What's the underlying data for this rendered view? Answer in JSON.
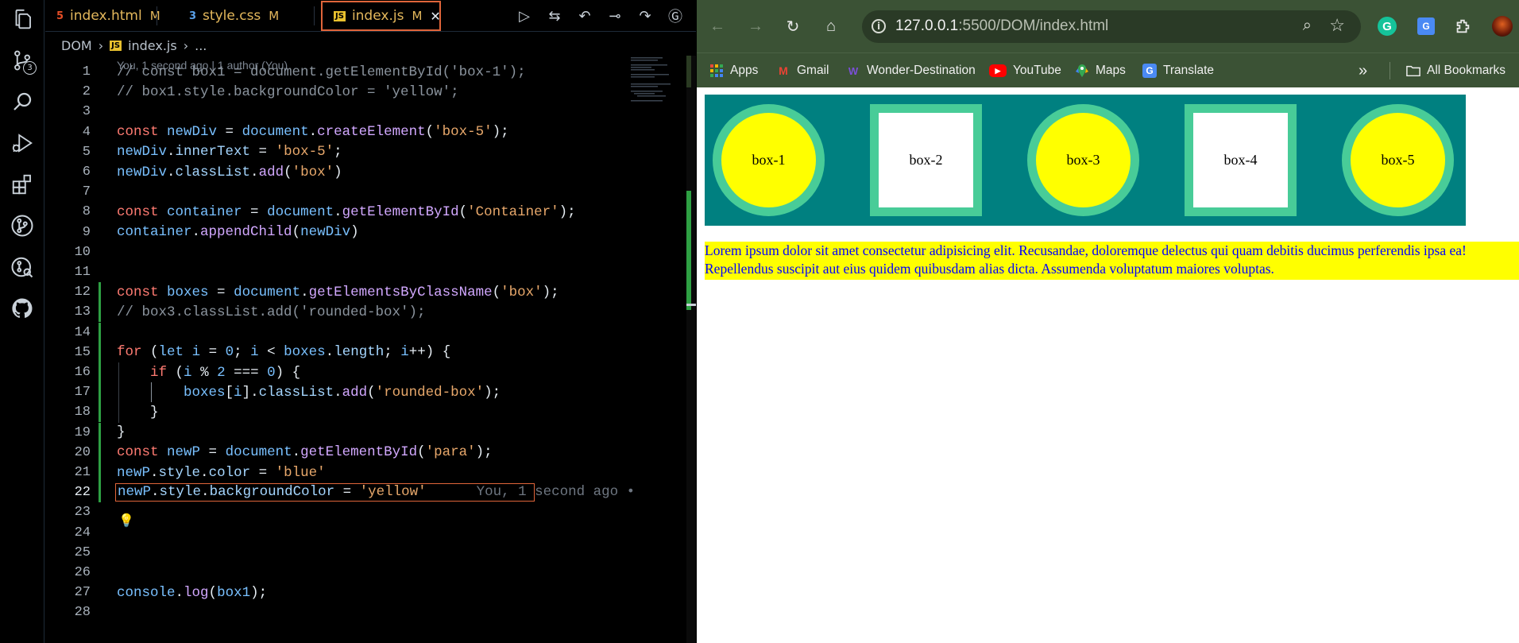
{
  "vscode": {
    "activity_bar": {
      "items": [
        {
          "name": "explorer-icon"
        },
        {
          "name": "source-control-icon",
          "badge": "3"
        },
        {
          "name": "search-icon"
        },
        {
          "name": "run-debug-icon"
        },
        {
          "name": "extensions-icon"
        },
        {
          "name": "git-graph-icon"
        },
        {
          "name": "remote-explorer-icon"
        },
        {
          "name": "github-icon"
        }
      ]
    },
    "tabs": [
      {
        "label": "index.html",
        "status": "M",
        "icon": "html-icon"
      },
      {
        "label": "style.css",
        "status": "M",
        "icon": "css-icon"
      },
      {
        "label": "index.js",
        "status": "M",
        "icon": "js-icon",
        "active": true
      }
    ],
    "breadcrumb": {
      "folder": "DOM",
      "file": "index.js",
      "rest": "..."
    },
    "blame_header": "You, 1 second ago | 1 author (You)",
    "lines": [
      {
        "n": "1",
        "html": "<span class='c-cmt'>// const box1 = document.getElementById('box-1');</span>"
      },
      {
        "n": "2",
        "html": "<span class='c-cmt'>// box1.style.backgroundColor = 'yellow';</span>"
      },
      {
        "n": "3",
        "html": ""
      },
      {
        "n": "4",
        "html": "<span class='c-kw'>const</span> <span class='c-var'>newDiv</span> = <span class='c-var'>document</span>.<span class='c-fn'>createElement</span>(<span class='c-str2'>'box-5'</span>);"
      },
      {
        "n": "5",
        "html": "<span class='c-var'>newDiv</span>.<span class='c-prop'>innerText</span> = <span class='c-str2'>'box-5'</span>;"
      },
      {
        "n": "6",
        "html": "<span class='c-var'>newDiv</span>.<span class='c-prop'>classList</span>.<span class='c-fn'>add</span>(<span class='c-str2'>'box'</span>)"
      },
      {
        "n": "7",
        "html": ""
      },
      {
        "n": "8",
        "html": "<span class='c-kw'>const</span> <span class='c-var'>container</span> = <span class='c-var'>document</span>.<span class='c-fn'>getElementById</span>(<span class='c-str2'>'Container'</span>);"
      },
      {
        "n": "9",
        "html": "<span class='c-var'>container</span>.<span class='c-fn'>appendChild</span>(<span class='c-var'>newDiv</span>)"
      },
      {
        "n": "10",
        "html": ""
      },
      {
        "n": "11",
        "html": ""
      },
      {
        "n": "12",
        "html": "<span class='c-kw'>const</span> <span class='c-var'>boxes</span> = <span class='c-var'>document</span>.<span class='c-fn'>getElementsByClassName</span>(<span class='c-str2'>'box'</span>);"
      },
      {
        "n": "13",
        "html": "<span class='c-cmt'>// box3.classList.add('rounded-box');</span>"
      },
      {
        "n": "14",
        "html": ""
      },
      {
        "n": "15",
        "html": "<span class='c-kw'>for</span> (<span class='c-kw2'>let</span> <span class='c-var'>i</span> = <span class='c-num'>0</span>; <span class='c-var'>i</span> &lt; <span class='c-var'>boxes</span>.<span class='c-prop'>length</span>; <span class='c-var'>i</span>++) {"
      },
      {
        "n": "16",
        "html": "    <span class='c-kw'>if</span> (<span class='c-var'>i</span> % <span class='c-num'>2</span> === <span class='c-num'>0</span>) {"
      },
      {
        "n": "17",
        "html": "        <span class='c-var'>boxes</span>[<span class='c-var'>i</span>].<span class='c-prop'>classList</span>.<span class='c-fn'>add</span>(<span class='c-str2'>'rounded-box'</span>);"
      },
      {
        "n": "18",
        "html": "    }"
      },
      {
        "n": "19",
        "html": "}"
      },
      {
        "n": "20",
        "html": "<span class='c-kw'>const</span> <span class='c-var'>newP</span> = <span class='c-var'>document</span>.<span class='c-fn'>getElementById</span>(<span class='c-str2'>'para'</span>);"
      },
      {
        "n": "21",
        "html": "<span class='c-var'>newP</span>.<span class='c-prop'>style</span>.<span class='c-prop'>color</span> = <span class='c-str2'>'blue'</span>"
      },
      {
        "n": "22",
        "html": "<span class='c-var'>newP</span>.<span class='c-prop'>style</span>.<span class='c-prop'>backgroundColor</span> = <span class='c-str2'>'yellow'</span>      <span class='c-ghost'>You, 1 second ago •</span>",
        "current": true
      },
      {
        "n": "23",
        "html": ""
      },
      {
        "n": "24",
        "html": ""
      },
      {
        "n": "25",
        "html": ""
      },
      {
        "n": "26",
        "html": ""
      },
      {
        "n": "27",
        "html": "<span class='c-var'>console</span>.<span class='c-fn'>log</span>(<span class='c-var'>box1</span>);"
      },
      {
        "n": "28",
        "html": ""
      }
    ]
  },
  "browser": {
    "url_host": "127.0.0.1",
    "url_rest": ":5500/DOM/index.html",
    "bookmarks": [
      {
        "label": "Apps",
        "icon": "apps-grid-icon"
      },
      {
        "label": "Gmail",
        "icon": "gmail-icon"
      },
      {
        "label": "Wonder-Destination",
        "icon": "wonder-icon"
      },
      {
        "label": "YouTube",
        "icon": "youtube-icon"
      },
      {
        "label": "Maps",
        "icon": "maps-icon"
      },
      {
        "label": "Translate",
        "icon": "translate-icon"
      }
    ],
    "all_bookmarks": "All Bookmarks",
    "page": {
      "boxes": [
        {
          "label": "box-1",
          "shape": "rounded"
        },
        {
          "label": "box-2",
          "shape": "square"
        },
        {
          "label": "box-3",
          "shape": "rounded"
        },
        {
          "label": "box-4",
          "shape": "square"
        },
        {
          "label": "box-5",
          "shape": "rounded"
        }
      ],
      "paragraph": "Lorem ipsum dolor sit amet consectetur adipisicing elit. Recusandae, doloremque delectus qui quam debitis ducimus perferendis ipsa ea! Repellendus suscipit aut eius quidem quibusdam alias dicta. Assumenda voluptatum maiores voluptas.",
      "colors": {
        "container": "#008080",
        "border": "#48cc98",
        "rounded_fill": "#ffff00",
        "square_fill": "#ffffff",
        "para_bg": "#ffff00",
        "para_text": "#0000ff"
      }
    }
  }
}
